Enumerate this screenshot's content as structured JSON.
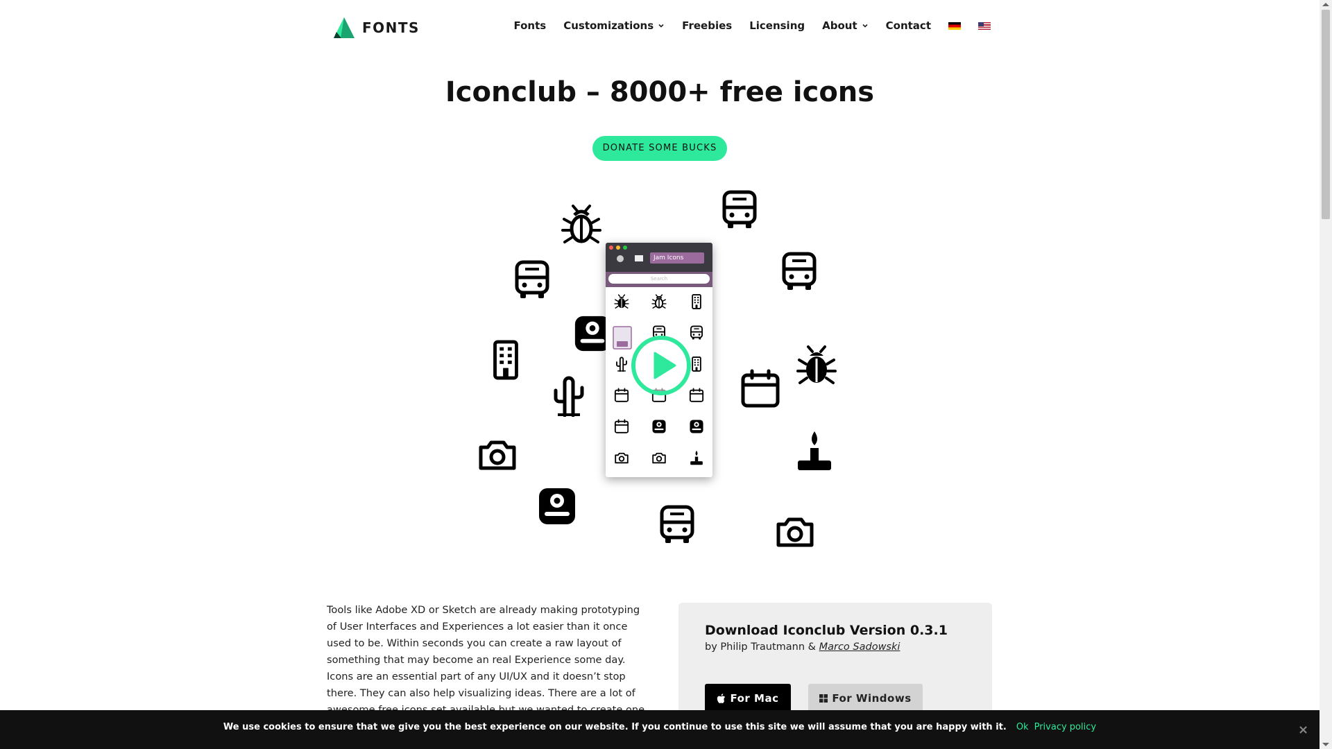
{
  "header": {
    "logo_text": "FONTS",
    "nav": [
      {
        "label": "Fonts"
      },
      {
        "label": "Customizations"
      },
      {
        "label": "Freebies"
      },
      {
        "label": "Licensing"
      },
      {
        "label": "About"
      },
      {
        "label": "Contact"
      }
    ]
  },
  "hero": {
    "title": "Iconclub – 8000+ free icons",
    "donate_label": "DONATE SOME BUCKS"
  },
  "app_mock": {
    "select_value": "Jam Icons",
    "search_placeholder": "Search"
  },
  "intro_text": "Tools like Adobe XD or Sketch are already making prototyping of User Interfaces and Experiences a lot easier than it once used to be. Within seconds you can create a raw layout of something that may become an real Experience some day. Icons are an essential part of any UI/UX and it doesn’t stop there. They can also help visualizing ideas. There are a lot of awesome free icons set available but we wanted to create one place to",
  "download": {
    "title": "Download Iconclub Version 0.3.1",
    "by_prefix": "by Philip Trautmann & ",
    "author2": "Marco Sadowski",
    "mac_label": "For Mac",
    "win_label": "For Windows"
  },
  "cookie": {
    "text": "We use cookies to ensure that we give you the best experience on our website. If you continue to use this site we will assume that you are happy with it.",
    "ok_label": "Ok",
    "privacy_label": "Privacy policy",
    "close_label": "×"
  },
  "colors": {
    "accent": "#2ee89b",
    "text": "#111111",
    "card_bg": "#eeeeee",
    "cookie_bg": "#111111"
  }
}
